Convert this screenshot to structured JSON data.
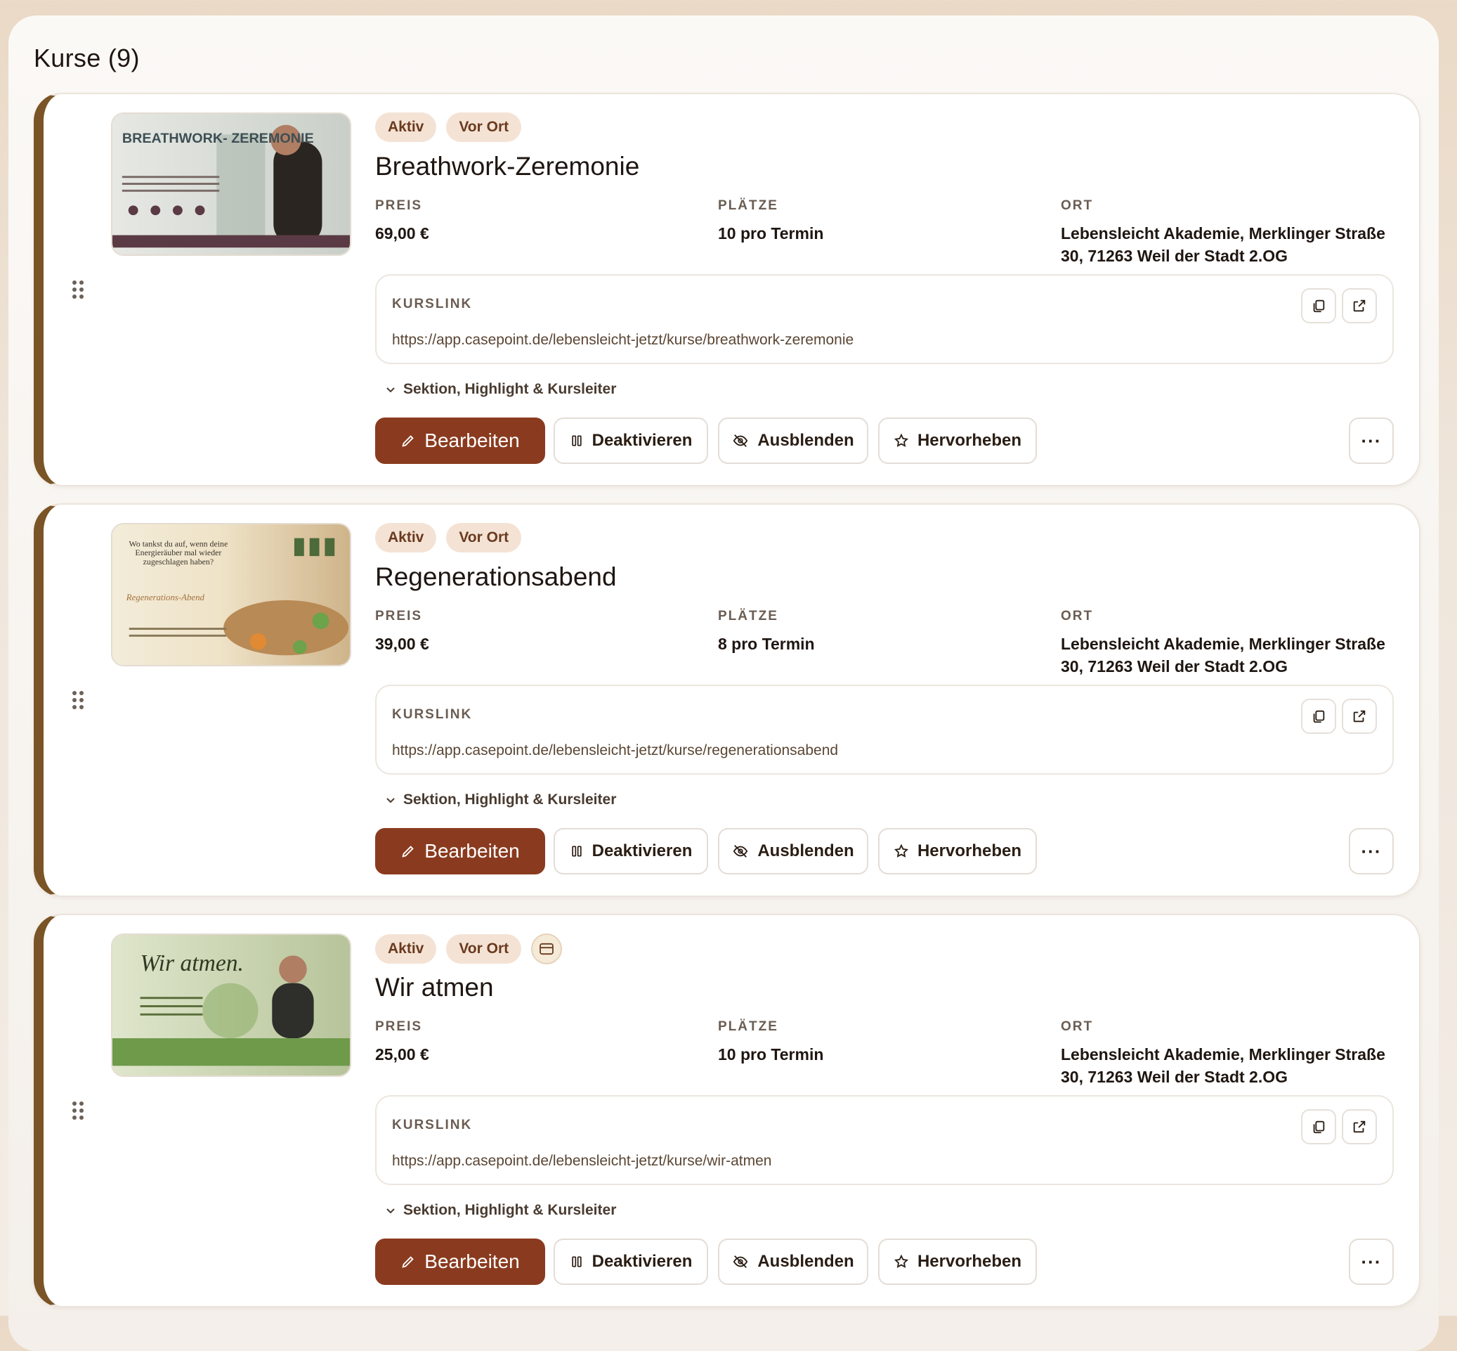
{
  "page": {
    "title": "Kurse (9)"
  },
  "labels": {
    "preis": "PREIS",
    "plaetze": "PLÄTZE",
    "ort": "ORT",
    "kurslink": "KURSLINK",
    "toggle": "Sektion, Highlight & Kursleiter",
    "edit": "Bearbeiten",
    "deactivate": "Deaktivieren",
    "hide": "Ausblenden",
    "feature": "Hervorheben",
    "more": "···"
  },
  "colors": {
    "accent": "#8a3b1f",
    "rail": "#7a5426",
    "badge_bg": "#f4e3d5",
    "badge_text": "#6a3a1e"
  },
  "courses": [
    {
      "badges": [
        "Aktiv",
        "Vor Ort"
      ],
      "has_payment_icon": false,
      "title": "Breathwork-Zeremonie",
      "preis": "69,00 €",
      "plaetze": "10 pro Termin",
      "ort": "Lebensleicht Akademie, Merklinger Straße 30, 71263 Weil der Stadt 2.OG",
      "url": "https://app.casepoint.de/lebensleicht-jetzt/kurse/breathwork-zeremonie",
      "thumb_text": "BREATHWORK- ZEREMONIE"
    },
    {
      "badges": [
        "Aktiv",
        "Vor Ort"
      ],
      "has_payment_icon": false,
      "title": "Regenerationsabend",
      "preis": "39,00 €",
      "plaetze": "8 pro Termin",
      "ort": "Lebensleicht Akademie, Merklinger Straße 30, 71263 Weil der Stadt 2.OG",
      "url": "https://app.casepoint.de/lebensleicht-jetzt/kurse/regenerationsabend",
      "thumb_text": "Wo tankst du auf, wenn deine Energieräuber mal wieder zugeschlagen haben?"
    },
    {
      "badges": [
        "Aktiv",
        "Vor Ort"
      ],
      "has_payment_icon": true,
      "title": "Wir atmen",
      "preis": "25,00 €",
      "plaetze": "10 pro Termin",
      "ort": "Lebensleicht Akademie, Merklinger Straße 30, 71263 Weil der Stadt 2.OG",
      "url": "https://app.casepoint.de/lebensleicht-jetzt/kurse/wir-atmen",
      "thumb_text": "Wir atmen."
    }
  ]
}
